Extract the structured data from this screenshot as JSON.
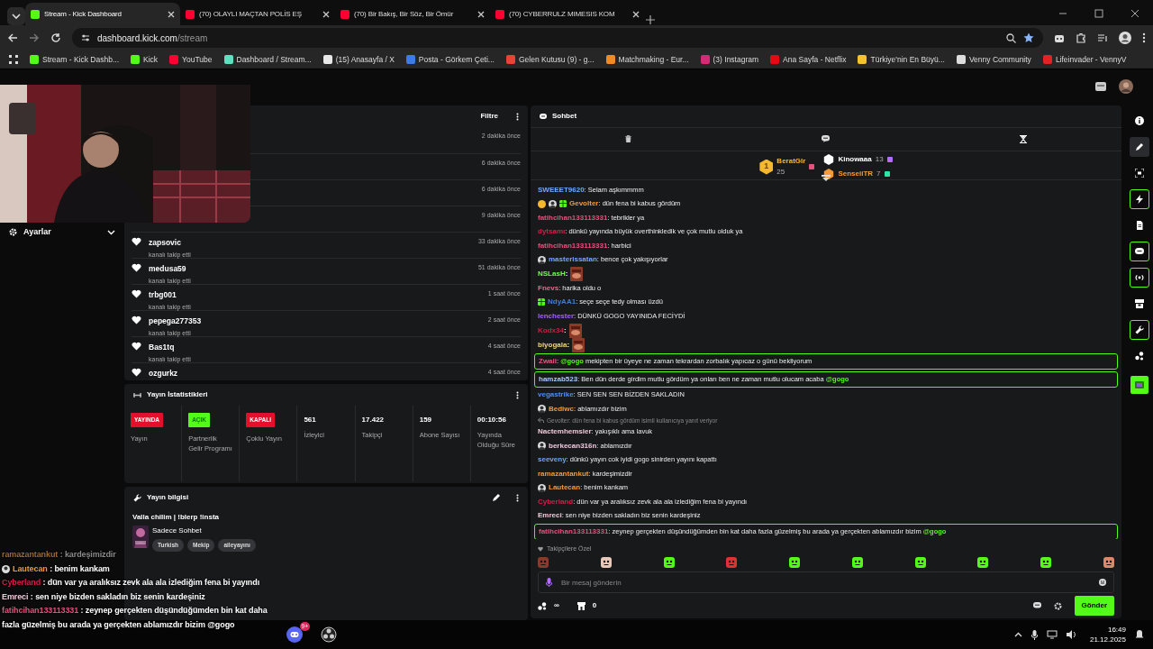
{
  "browser": {
    "tabs": [
      {
        "title": "Stream - Kick Dashboard",
        "selected": true,
        "color": "#53fc18"
      },
      {
        "title": "(70) OLAYLI MAÇTAN POLİS EŞ",
        "selected": false,
        "color": "#ff0033"
      },
      {
        "title": "(70) Bir Bakış, Bir Söz, Bir Ömür",
        "selected": false,
        "color": "#ff0033"
      },
      {
        "title": "(70) CYBERRULZ MIMESIS KOM",
        "selected": false,
        "color": "#ff0033"
      }
    ],
    "address": {
      "host": "dashboard.kick.com",
      "path": "/stream"
    },
    "bookmarks": [
      {
        "label": "Stream - Kick Dashb...",
        "color": "#53fc18"
      },
      {
        "label": "Kick",
        "color": "#53fc18"
      },
      {
        "label": "YouTube",
        "color": "#ff0033"
      },
      {
        "label": "Dashboard / Stream...",
        "color": "#5ee0c0"
      },
      {
        "label": "(15) Anasayfa / X",
        "color": "#e7e7e7"
      },
      {
        "label": "Posta - Görkem Çeti...",
        "color": "#3d7be8"
      },
      {
        "label": "Gelen Kutusu (9) - g...",
        "color": "#ea4335"
      },
      {
        "label": "Matchmaking - Eur...",
        "color": "#f08a24"
      },
      {
        "label": "(3) Instagram",
        "color": "#d62976"
      },
      {
        "label": "Ana Sayfa - Netflix",
        "color": "#e50914"
      },
      {
        "label": "Türkiye'nin En Büyü...",
        "color": "#f2c230"
      },
      {
        "label": "Venny Community",
        "color": "#dddddd"
      },
      {
        "label": "Lifeinvader - VennyV",
        "color": "#e02424"
      }
    ]
  },
  "sidebar": {
    "items": [
      {
        "label": "Ayarlar"
      }
    ]
  },
  "activity": {
    "filter": "Filtre",
    "items": [
      {
        "time": "2 dakika önce"
      },
      {
        "time": "6 dakika önce"
      },
      {
        "time": "6 dakika önce"
      },
      {
        "time": "9 dakika önce"
      },
      {
        "user": "zapsovic",
        "action": "kanalı takip etti",
        "time": "33 dakika önce"
      },
      {
        "user": "medusa59",
        "action": "kanalı takip etti",
        "time": "51 dakika önce"
      },
      {
        "user": "trbg001",
        "action": "kanalı takip etti",
        "time": "1 saat önce"
      },
      {
        "user": "pepega277353",
        "action": "kanalı takip etti",
        "time": "2 saat önce"
      },
      {
        "user": "Bas1tq",
        "action": "kanalı takip etti",
        "time": "4 saat önce"
      },
      {
        "user": "ozgurkz",
        "time": "4 saat önce"
      }
    ]
  },
  "stats": {
    "title": "Yayın İstatistikleri",
    "cells": [
      {
        "kind": "status",
        "badge": "YAYINDA",
        "color": "#e3102c",
        "label": "Yayın"
      },
      {
        "kind": "status",
        "badge": "AÇIK",
        "color": "#53fc18",
        "label": "Partnerlik Gelir Programı"
      },
      {
        "kind": "status",
        "badge": "KAPALI",
        "color": "#e3102c",
        "label": "Çoklu Yayın"
      },
      {
        "kind": "number",
        "value": "561",
        "label": "İzleyici"
      },
      {
        "kind": "number",
        "value": "17.422",
        "label": "Takipçi"
      },
      {
        "kind": "number",
        "value": "159",
        "label": "Abone Sayısı"
      },
      {
        "kind": "number",
        "value": "00:10:56",
        "label": "Yayında Olduğu Süre"
      }
    ]
  },
  "stream_info": {
    "title": "Yayın bilgisi",
    "stream_title": "Valla chilim | !blerp !insta",
    "category": "Sadece Sohbet",
    "tags": [
      "Turkish",
      "Mekip",
      "aileyayını"
    ]
  },
  "chat": {
    "title": "Sohbet",
    "leaders": [
      {
        "rank": "1",
        "user": "BeratGlr",
        "count": "25",
        "color": "#f5b82e"
      },
      {
        "user": "Kinowaaa",
        "count": "13",
        "color": "#ffffff"
      },
      {
        "user": "SenseiiTR",
        "count": "7",
        "color": "#f29b38"
      }
    ],
    "messages": [
      {
        "kind": "text",
        "user": "SWEEET9620",
        "color": "#73a9ff",
        "text": ": Selam aşkımmmm",
        "highlighted": false
      },
      {
        "kind": "text",
        "badges": [
          {
            "kind": "rank"
          },
          {
            "kind": "avatar"
          },
          {
            "kind": "gift"
          }
        ],
        "user": "Gevolter",
        "color": "#f29b38",
        "text": ": dün fena bi kabus gördüm",
        "highlighted": false
      },
      {
        "kind": "text",
        "user": "fatihcihan133113331",
        "color": "#e5527d",
        "text": ": tebrikler ya",
        "highlighted": false
      },
      {
        "kind": "text",
        "user": "dytsamı",
        "color": "#d61f4a",
        "text": ": dünkü yayında büyük overthinkledik ve çok mutlu olduk ya",
        "highlighted": false
      },
      {
        "kind": "text",
        "user": "fatihcihan133113331",
        "color": "#e5527d",
        "text": ": harbici",
        "highlighted": false
      },
      {
        "kind": "text",
        "badges": [
          {
            "kind": "avatar"
          }
        ],
        "user": "masterissatan",
        "color": "#75a7ff",
        "text": ": bence çok yakışıyorlar",
        "highlighted": false
      },
      {
        "kind": "emote",
        "user": "NSLasH",
        "color": "#6cff4d",
        "text": ":"
      },
      {
        "kind": "text",
        "user": "Fnevs",
        "color": "#e26a8a",
        "text": ": harika oldu o",
        "highlighted": false
      },
      {
        "kind": "text",
        "badges": [
          {
            "kind": "gift"
          }
        ],
        "user": "NdyAA1",
        "color": "#3f7fd9",
        "text": ": seçe seçe tedy olması üzdü",
        "highlighted": false
      },
      {
        "kind": "text",
        "user": "lenchester",
        "color": "#a560ff",
        "text": ": DÜNKÜ GOGO YAYINIDA FECİYDİ",
        "highlighted": false
      },
      {
        "kind": "emote",
        "user": "Kodx34",
        "color": "#c8203e",
        "text": ":"
      },
      {
        "kind": "emote",
        "user": "biyogala",
        "color": "#f3d27a",
        "text": ":"
      },
      {
        "kind": "text",
        "user": "Zwaii",
        "color": "#e2577e",
        "separator": ":",
        "lead_mention": "@gogo",
        "text": "mekipten bir üyeye ne zaman tekrardan zorbalık yapıcaz o günü bekliyorum",
        "highlighted": true
      },
      {
        "kind": "text",
        "user": "hamzab523",
        "color": "#a8c8ff",
        "text": ": Ben dün derde girdim mutlu gördüm ya onları ben ne zaman mutlu olucam acaba",
        "mention": "@gogo",
        "highlighted": true
      },
      {
        "kind": "text",
        "user": "vegastrike",
        "color": "#4d8dff",
        "text": ": SEN SEN SEN BİZDEN SAKLADIN",
        "highlighted": false
      },
      {
        "kind": "text",
        "badges": [
          {
            "kind": "avatar"
          }
        ],
        "user": "Bediwc",
        "color": "#f29b38",
        "text": ": ablamızdır bizim",
        "highlighted": false
      },
      {
        "kind": "reply",
        "text": "Gevolter: dün fena bi kabus gördüm isimli kullanıcıya yanıt veriyor"
      },
      {
        "kind": "text",
        "user": "Nactemhemsier",
        "color": "#f0c8d8",
        "text": ": yakışıklı ama lavuk",
        "highlighted": false
      },
      {
        "kind": "text",
        "badges": [
          {
            "kind": "avatar"
          }
        ],
        "user": "berkecan316n",
        "color": "#f0c8e0",
        "text": ": ablamızdır",
        "highlighted": false
      },
      {
        "kind": "text",
        "user": "seeveny",
        "color": "#6ea8fe",
        "text": ": dünkü yayın cok iyidi gogo sinirden yayını kapattı",
        "highlighted": false
      },
      {
        "kind": "text",
        "user": "ramazantankut",
        "color": "#f29b38",
        "text": ": kardeşimizdir",
        "highlighted": false
      },
      {
        "kind": "text",
        "badges": [
          {
            "kind": "avatar"
          }
        ],
        "user": "Lautecan",
        "color": "#f29b38",
        "text": ": benim kankam",
        "highlighted": false
      },
      {
        "kind": "text",
        "user": "Cyberland",
        "color": "#d61f4a",
        "text": ": dün var ya aralıksız zevk ala ala izlediğim fena bi yayındı",
        "highlighted": false
      },
      {
        "kind": "text",
        "user": "Emreci",
        "color": "#f0c8d8",
        "text": ": sen niye bizden sakladın biz senin kardeşiniz",
        "highlighted": false
      },
      {
        "kind": "text",
        "user": "fatihcihan133113331",
        "color": "#e5527d",
        "text": ": zeynep gerçekten düşündüğümden bin kat daha fazla güzelmiş bu arada ya gerçekten ablamızdır bizim",
        "mention": "@gogo",
        "highlighted": true
      }
    ],
    "followers_only": "Takipçilere Özel",
    "placeholder": "Bir mesaj gönderin",
    "points": "∞",
    "gifts": "0",
    "send": "Gönder"
  },
  "rail": [
    {
      "outlined": false,
      "selected": false
    },
    {
      "outlined": false,
      "selected": true
    },
    {
      "outlined": false,
      "selected": false
    },
    {
      "outlined": true,
      "selected": false
    },
    {
      "outlined": false,
      "selected": false
    },
    {
      "outlined": true,
      "selected": false
    },
    {
      "outlined": true,
      "selected": false
    },
    {
      "outlined": false,
      "selected": false
    },
    {
      "outlined": true,
      "selected": false
    },
    {
      "outlined": false,
      "selected": false
    }
  ],
  "overlay_chat": [
    {
      "user": "ramazantankut",
      "color": "#9a6a32",
      "text": ": kardeşimizdir",
      "faded": true
    },
    {
      "badges": [
        {
          "kind": "avatar"
        }
      ],
      "user": "Lautecan",
      "color": "#f29b38",
      "text": ": benim kankam",
      "faded": false
    },
    {
      "user": "Cyberland",
      "color": "#d61f4a",
      "text": ": dün var ya aralıksız zevk ala ala izlediğim fena bi yayındı",
      "faded": false
    },
    {
      "user": "Emreci",
      "color": "#f0c8d8",
      "text": ": sen niye bizden sakladın biz senin kardeşiniz",
      "faded": false
    },
    {
      "user": "fatihcihan133113331",
      "color": "#e5527d",
      "text": ": zeynep gerçekten düşündüğümden bin kat daha fazla güzelmiş bu arada ya gerçekten ablamızdır bizim",
      "mention": "@gogo",
      "faded": false
    }
  ],
  "taskbar": {
    "discord_badge": "9+",
    "time": "16:49",
    "date": "21.12.2025"
  }
}
